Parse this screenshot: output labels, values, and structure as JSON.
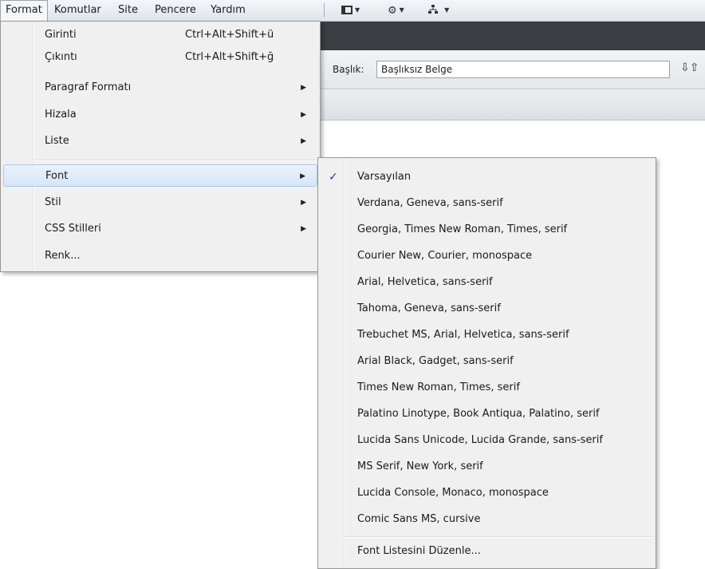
{
  "menubar": {
    "items": [
      "Format",
      "Komutlar",
      "Site",
      "Pencere",
      "Yardım"
    ],
    "toolbar_caret": "▼"
  },
  "document": {
    "title_label": "Başlık:",
    "title_value": "Başlıksız Belge"
  },
  "format_menu": {
    "items": [
      {
        "label": "Girinti",
        "shortcut": "Ctrl+Alt+Shift+ü"
      },
      {
        "label": "Çıkıntı",
        "shortcut": "Ctrl+Alt+Shift+ğ"
      },
      {
        "label": "Paragraf Formatı",
        "submenu": true
      },
      {
        "label": "Hizala",
        "submenu": true
      },
      {
        "label": "Liste",
        "submenu": true
      },
      {
        "label": "Font",
        "submenu": true,
        "highlighted": true
      },
      {
        "label": "Stil",
        "submenu": true
      },
      {
        "label": "CSS Stilleri",
        "submenu": true
      },
      {
        "label": "Renk..."
      }
    ]
  },
  "font_submenu": {
    "items": [
      {
        "label": "Varsayılan",
        "checked": true
      },
      {
        "label": "Verdana, Geneva, sans-serif"
      },
      {
        "label": "Georgia, Times New Roman, Times, serif"
      },
      {
        "label": "Courier New, Courier, monospace"
      },
      {
        "label": "Arial, Helvetica, sans-serif"
      },
      {
        "label": "Tahoma, Geneva, sans-serif"
      },
      {
        "label": "Trebuchet MS, Arial, Helvetica, sans-serif"
      },
      {
        "label": "Arial Black, Gadget, sans-serif"
      },
      {
        "label": "Times New Roman, Times, serif"
      },
      {
        "label": "Palatino Linotype, Book Antiqua, Palatino, serif"
      },
      {
        "label": "Lucida Sans Unicode, Lucida Grande, sans-serif"
      },
      {
        "label": "MS Serif, New York, serif"
      },
      {
        "label": "Lucida Console, Monaco, monospace"
      },
      {
        "label": "Comic Sans MS, cursive"
      }
    ],
    "edit_item": "Font Listesini Düzenle...",
    "check_glyph": "✓"
  },
  "colors": {
    "highlight": "#d6e6f7",
    "check": "#1c3f94",
    "menu_bg": "#f0f0f0"
  }
}
